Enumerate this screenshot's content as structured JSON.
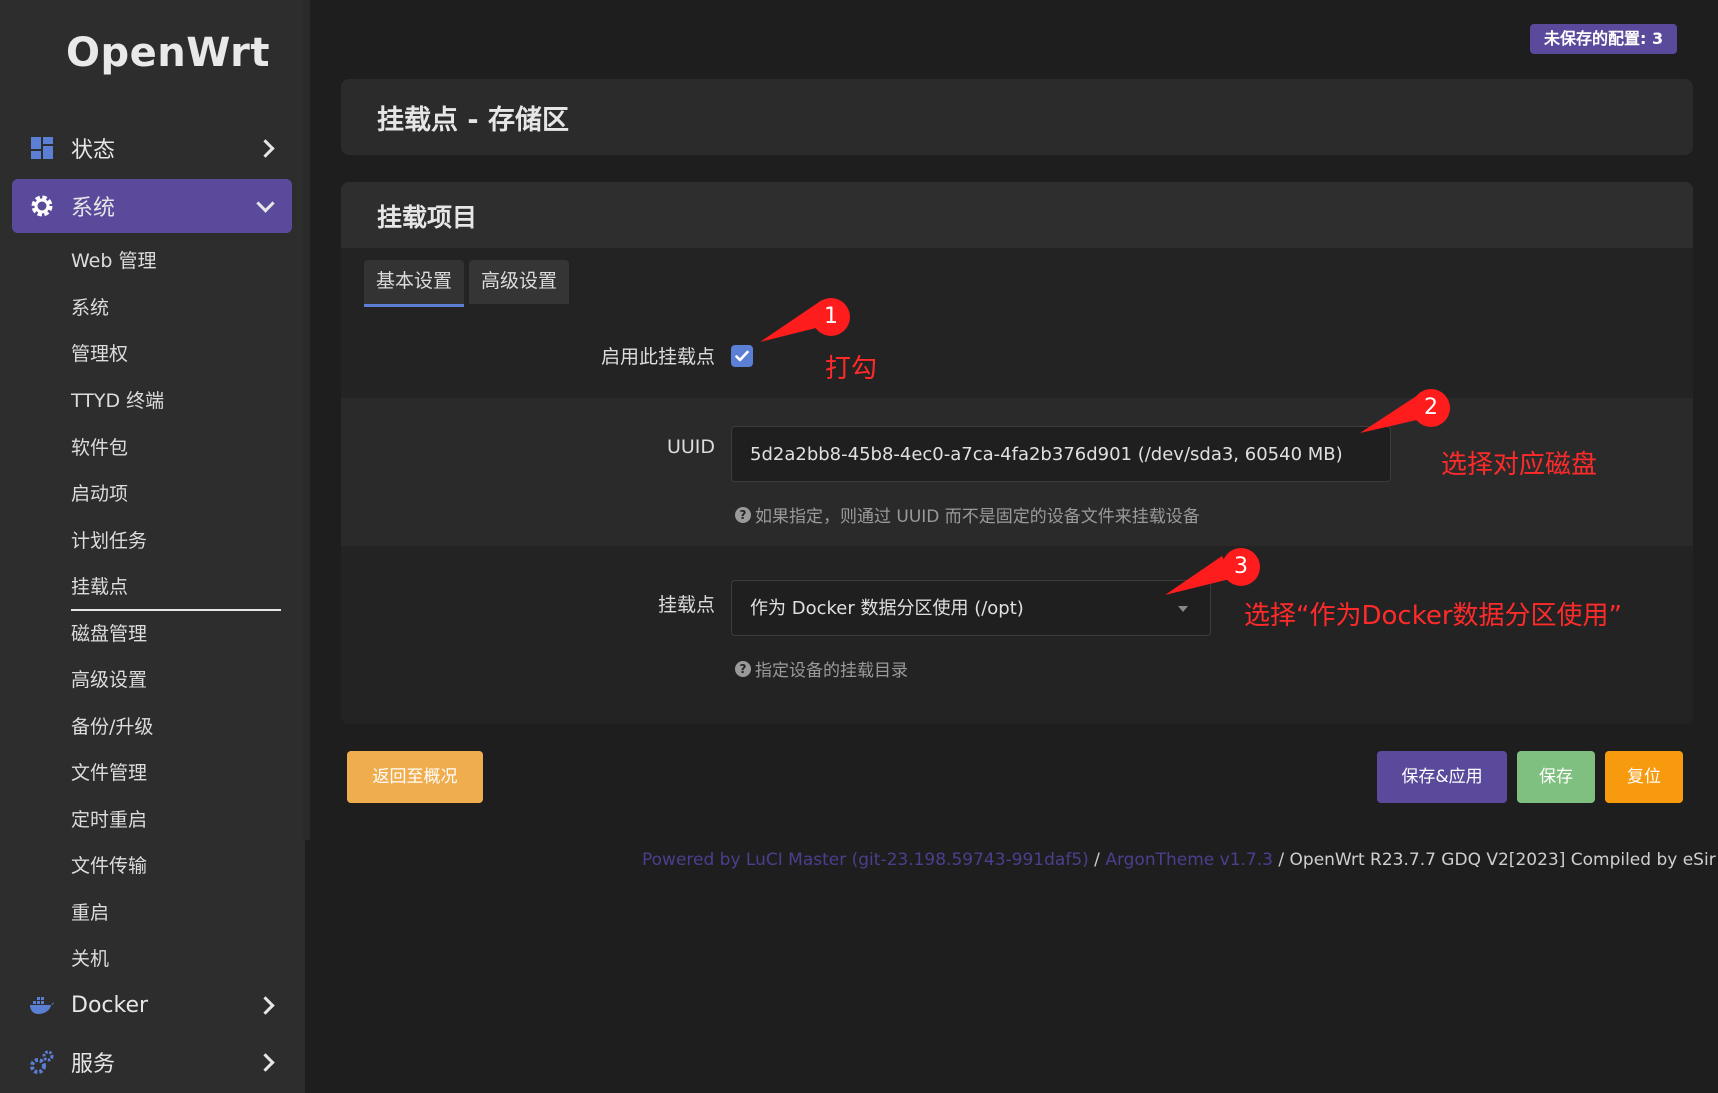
{
  "brand": "OpenWrt",
  "unsaved_badge": "未保存的配置: 3",
  "sidebar": {
    "status": "状态",
    "system": "系统",
    "sub_items": [
      "Web 管理",
      "系统",
      "管理权",
      "TTYD 终端",
      "软件包",
      "启动项",
      "计划任务",
      "挂载点",
      "磁盘管理",
      "高级设置",
      "备份/升级",
      "文件管理",
      "定时重启",
      "文件传输",
      "重启",
      "关机"
    ],
    "current_sub": "挂载点",
    "docker": "Docker",
    "services": "服务"
  },
  "page_title": "挂载点 - 存储区",
  "section_title": "挂载项目",
  "tabs": [
    "基本设置",
    "高级设置"
  ],
  "form": {
    "enable_label": "启用此挂载点",
    "enable_checked": true,
    "uuid_label": "UUID",
    "uuid_value": "5d2a2bb8-45b8-4ec0-a7ca-4fa2b376d901 (/dev/sda3, 60540 MB)",
    "uuid_help": "如果指定，则通过 UUID 而不是固定的设备文件来挂载设备",
    "mount_label": "挂载点",
    "mount_value": "作为 Docker 数据分区使用 (/opt)",
    "mount_help": "指定设备的挂载目录"
  },
  "buttons": {
    "back": "返回至概况",
    "save_apply": "保存&应用",
    "save": "保存",
    "reset": "复位"
  },
  "footer": {
    "luci": "Powered by LuCI Master (git-23.198.59743-991daf5)",
    "sep1": " / ",
    "theme": "ArgonTheme v1.7.3",
    "sep2": " / ",
    "rest": "OpenWrt R23.7.7 GDQ V2[2023] Compiled by eSir"
  },
  "annotations": {
    "n1": "1",
    "t1": "打勾",
    "n2": "2",
    "t2": "选择对应磁盘",
    "n3": "3",
    "t3": "选择“作为Docker数据分区使用”"
  },
  "colors": {
    "accent": "#5b4a9c",
    "checkbox": "#5c7fd6",
    "back_button": "#f0ad4e",
    "save_button": "#7fbf7f",
    "reset_button": "#f79a0e",
    "annotation": "#ff2a2a"
  }
}
